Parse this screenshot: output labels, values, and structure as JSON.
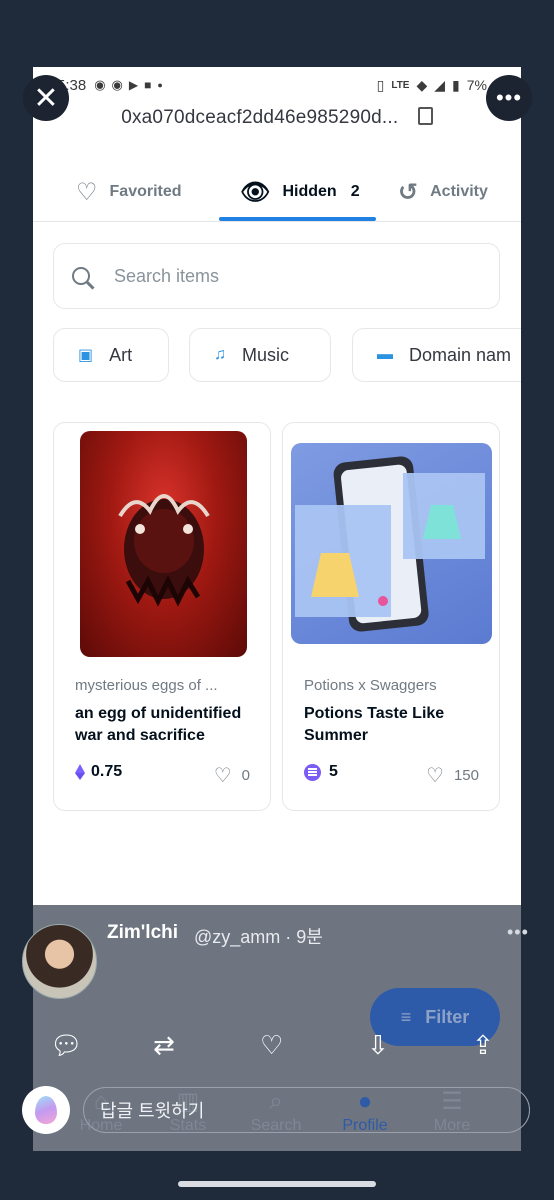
{
  "status_bar": {
    "time": "5:38",
    "battery": "7%"
  },
  "header": {
    "address": "0xa070dceacf2dd46e985290d..."
  },
  "tabs": [
    {
      "label": "Favorited",
      "icon": "heart-outline-icon"
    },
    {
      "label": "Hidden",
      "count": "2",
      "icon": "eye-icon",
      "active": true
    },
    {
      "label": "Activity",
      "icon": "history-icon"
    }
  ],
  "search": {
    "placeholder": "Search items"
  },
  "categories": [
    {
      "label": "Art",
      "icon": "art-icon"
    },
    {
      "label": "Music",
      "icon": "music-icon"
    },
    {
      "label": "Domain nam",
      "icon": "domain-icon"
    }
  ],
  "items": [
    {
      "collection": "mysterious eggs of ...",
      "name": "an egg of unidentified war and sacrifice",
      "price": "0.75",
      "currency": "eth",
      "favorites": "0"
    },
    {
      "collection": "Potions x Swaggers",
      "name": "Potions Taste Like Summer",
      "price": "5",
      "currency": "sol",
      "favorites": "150"
    }
  ],
  "filter": {
    "label": "Filter"
  },
  "bottom_nav": [
    {
      "label": "Home"
    },
    {
      "label": "Stats"
    },
    {
      "label": "Search"
    },
    {
      "label": "Profile",
      "active": true
    },
    {
      "label": "More"
    }
  ],
  "tweet": {
    "name": "Zim'lchi",
    "handle": "@zy_amm · 9분",
    "reply_placeholder": "답글 트윗하기"
  },
  "colors": {
    "accent": "#2081e2",
    "text": "#04111d",
    "muted": "#707a83",
    "overlay": "#5a6270"
  }
}
